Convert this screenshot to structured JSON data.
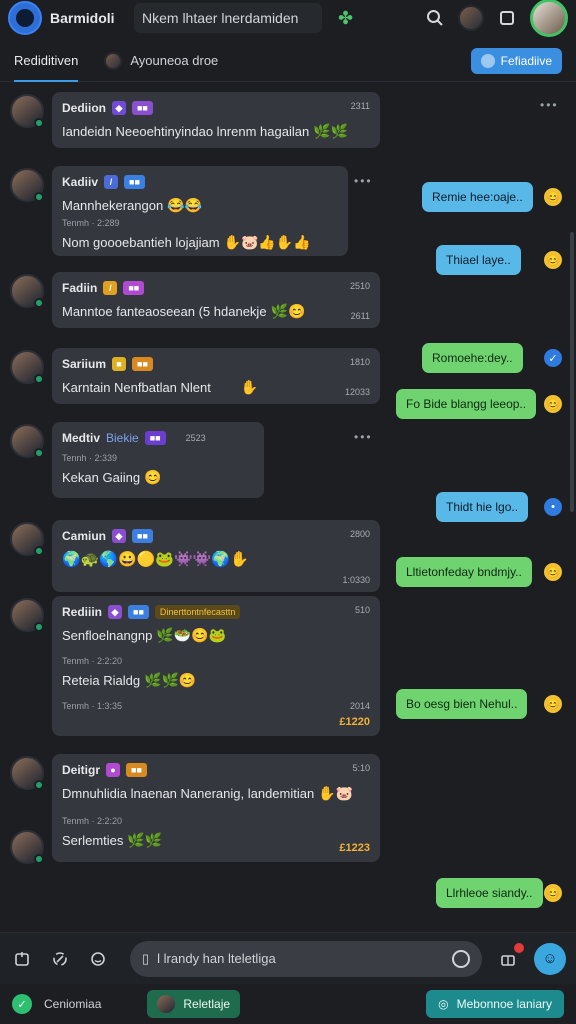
{
  "header": {
    "app_title": "Barmidoli",
    "search_text": "Nkem lhtaer lnerdamiden",
    "icons": [
      "logo-icon",
      "leaf-icon",
      "search-icon",
      "contact-avatar",
      "square-icon",
      "profile-avatar"
    ]
  },
  "tabs": [
    {
      "label": "Rediditiven",
      "active": true
    },
    {
      "label": "Ayouneoa droe",
      "active": false
    }
  ],
  "tab_button": "Fefiadiive",
  "messages": [
    {
      "name": "Dediion",
      "time": "2311",
      "text": "Iandeidn Neeoehtinyindao lnrenm hagailan",
      "emoji": "🌿🌿"
    },
    {
      "name": "Kadiiv",
      "sub": "Tenmh · 2:289",
      "text": "Mannhekerangon",
      "emoji": "😂😂",
      "text2": "Nom goooebantieh lojajiam",
      "emoji2": "✋🐷👍✋👍"
    },
    {
      "name": "Fadiin",
      "time": "2510",
      "time2": "2611",
      "text": "Manntoe fanteaoseean (5 hdanekje",
      "emoji": "🌿😊"
    },
    {
      "name": "Sariium",
      "time": "1810",
      "time2": "12033",
      "text": "Karntain Nenfbatlan Nlent",
      "emoji": "✋"
    },
    {
      "name": "Medtiv",
      "tag": "Biekie",
      "time": "2523",
      "sub": "Tennh · 2:339",
      "text": "Kekan Gaiing",
      "emoji": "😊"
    },
    {
      "name": "Camiun",
      "time": "2800",
      "time2": "1:0330",
      "emoji": "🌍🐢🌎😀🟡🐸👾👾🌍✋"
    },
    {
      "name": "Rediiin",
      "time": "510",
      "tag": "Dinerttontnfecasttn",
      "text": "Senfloelnangnp",
      "emoji": "🌿🥗😊🐸",
      "sub": "Tenmh · 2:2:20",
      "text2": "Reteia Rialdg",
      "emoji2": "🌿🌿😊",
      "sub2": "Tenmh · 1:3:35",
      "time2": "2014",
      "price": "£1220"
    },
    {
      "name": "Deitigr",
      "time": "5:10",
      "text": "Dmnuhlidia lnaenan Naneranig, landemitian",
      "emoji": "✋🐷",
      "sub": "Tenmh · 2:2:20",
      "text2": "Serlemties",
      "emoji2": "🌿🌿",
      "price": "£1223"
    }
  ],
  "outgoing": [
    {
      "text": "Remie hee:oaje..",
      "color": "blue",
      "react": "😊"
    },
    {
      "text": "Thiael laye..",
      "color": "blue",
      "react": "😊"
    },
    {
      "text": "Romoehe:dey..",
      "color": "green",
      "react": "✓"
    },
    {
      "text": "Fo Bide blangg leeop..",
      "color": "green",
      "react": "😊"
    },
    {
      "text": "Thidt hie lgo..",
      "color": "blue",
      "react": "•"
    },
    {
      "text": "Lltietonfeday bndmjy..",
      "color": "green",
      "react": "😊"
    },
    {
      "text": "Bo oesg bien Nehul..",
      "color": "green",
      "react": "😊"
    },
    {
      "text": "Llrhleoe siandy..",
      "color": "green",
      "react": "😊"
    }
  ],
  "composer": {
    "placeholder": "l lrandy han lteletliga"
  },
  "bottombar": {
    "left_label": "Ceniomiaa",
    "mid_label": "Reletlaje",
    "right_label": "Mebonnoe laniary"
  },
  "colors": {
    "accent": "#3b9be6",
    "bubble_blue": "#58b8e8",
    "bubble_green": "#6fd36f",
    "bg": "#1c1e22",
    "bubble_bg": "#34373d",
    "price": "#f2b233"
  }
}
